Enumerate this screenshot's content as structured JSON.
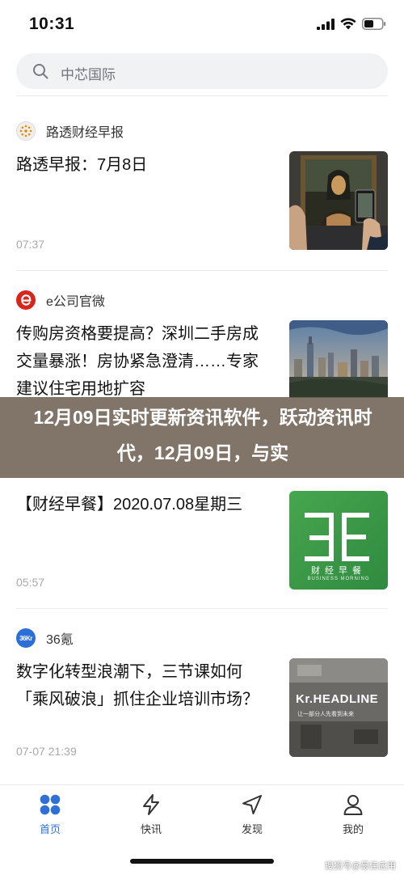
{
  "status_bar": {
    "time": "10:31",
    "icons": [
      "signal-icon",
      "wifi-icon",
      "battery-icon"
    ]
  },
  "search": {
    "placeholder": "中芯国际"
  },
  "feed": [
    {
      "source": "路透财经早报",
      "logo_text": "REUTERS",
      "headline": "路透早报：7月8日",
      "time": "07:37",
      "thumb": "mona-lisa-photo"
    },
    {
      "source": "e公司官微",
      "logo_text": "e",
      "headline": "传购房资格要提高？深圳二手房成交量暴涨！房协紧急澄清……专家建议住宅用地扩容",
      "time": "",
      "thumb": "shenzhen-skyline-photo"
    },
    {
      "source": "",
      "logo_text": "",
      "headline": "【财经早餐】2020.07.08星期三",
      "time": "05:57",
      "thumb": "caijing-zaocan-logo",
      "thumb_title": "财经早餐",
      "thumb_subtitle": "BUSINESS MORNING"
    },
    {
      "source": "36氪",
      "logo_text": "36Kr",
      "headline": "数字化转型浪潮下，三节课如何「乘风破浪」抓住企业培训市场？",
      "time": "07-07 21:39",
      "thumb": "kr-headline-photo",
      "thumb_title": "Kr.HEADLINE",
      "thumb_subtitle": "让一部分人先看到未来"
    }
  ],
  "banner": {
    "text": "12月09日实时更新资讯软件，跃动资讯时代，12月09日，与实"
  },
  "tabs": [
    {
      "label": "首页",
      "icon": "home-grid-icon",
      "active": true
    },
    {
      "label": "快讯",
      "icon": "lightning-icon",
      "active": false
    },
    {
      "label": "发现",
      "icon": "navigation-arrow-icon",
      "active": false
    },
    {
      "label": "我的",
      "icon": "profile-icon",
      "active": false
    }
  ],
  "watermark": "搜狐号@最佳应用",
  "colors": {
    "accent": "#2f6fd6",
    "banner": "#706254",
    "search_bg": "#f1f2f4"
  }
}
